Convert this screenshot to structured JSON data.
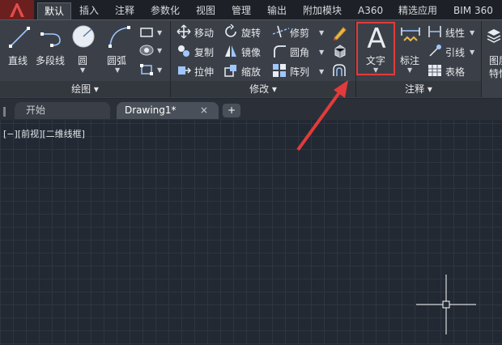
{
  "ribbon_tabs": [
    "默认",
    "插入",
    "注释",
    "参数化",
    "视图",
    "管理",
    "输出",
    "附加模块",
    "A360",
    "精选应用",
    "BIM 360"
  ],
  "draw_panel": {
    "line": "直线",
    "polyline": "多段线",
    "circle": "圆",
    "arc": "圆弧",
    "title": "绘图 ▾"
  },
  "modify_panel": {
    "move": "移动",
    "rotate": "旋转",
    "trim": "修剪",
    "copy": "复制",
    "mirror": "镜像",
    "fillet": "圆角",
    "stretch": "拉伸",
    "scale": "缩放",
    "array": "阵列",
    "title": "修改 ▾"
  },
  "annotation_panel": {
    "text": "文字",
    "dimension": "标注",
    "linear": "线性",
    "leader": "引线",
    "table": "表格",
    "title": "注释 ▾"
  },
  "layers_panel": {
    "label_top": "图层",
    "label_bottom": "特性"
  },
  "file_tabs": {
    "start": "开始",
    "drawing": "Drawing1*",
    "close": "×",
    "add": "+"
  },
  "viewport_label": "[−][前视][二维线框]",
  "colors": {
    "highlight": "#e23b3b",
    "ribbon_bg": "#3b4048",
    "canvas_bg": "#222933"
  }
}
